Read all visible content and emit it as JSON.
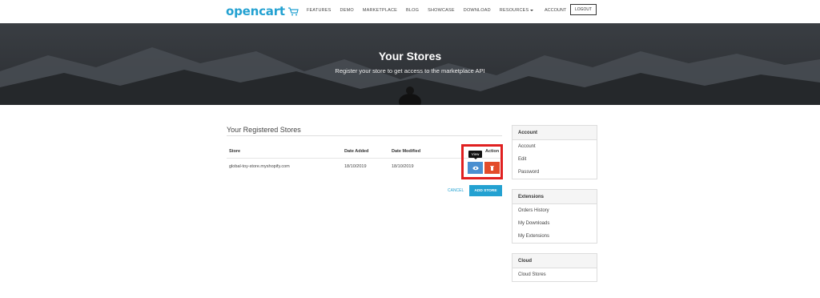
{
  "header": {
    "logo_text": "opencart",
    "nav": [
      "FEATURES",
      "DEMO",
      "MARKETPLACE",
      "BLOG",
      "SHOWCASE",
      "DOWNLOAD",
      "RESOURCES"
    ],
    "account_label": "ACCOUNT",
    "logout_label": "LOGOUT"
  },
  "hero": {
    "title": "Your Stores",
    "subtitle": "Register your store to get access to the marketplace API"
  },
  "main": {
    "section_title": "Your Registered Stores",
    "columns": [
      "Store",
      "Date Added",
      "Date Modified",
      "Action"
    ],
    "rows": [
      {
        "store": "global-toy-store.myshopify.com",
        "date_added": "18/10/2019",
        "date_modified": "18/10/2019"
      }
    ],
    "tooltip": "View",
    "cancel_label": "CANCEL",
    "add_store_label": "ADD STORE"
  },
  "sidebar": {
    "panels": [
      {
        "title": "Account",
        "items": [
          "Account",
          "Edit",
          "Password"
        ]
      },
      {
        "title": "Extensions",
        "items": [
          "Orders History",
          "My Downloads",
          "My Extensions"
        ]
      },
      {
        "title": "Cloud",
        "items": [
          "Cloud Stores"
        ]
      }
    ]
  },
  "colors": {
    "brand": "#23a1d1",
    "view_button": "#4a8fd0",
    "delete_button": "#e34b2a",
    "highlight": "#e02020"
  },
  "icons": {
    "view": "eye-icon",
    "delete": "trash-icon",
    "cart": "cart-icon"
  }
}
